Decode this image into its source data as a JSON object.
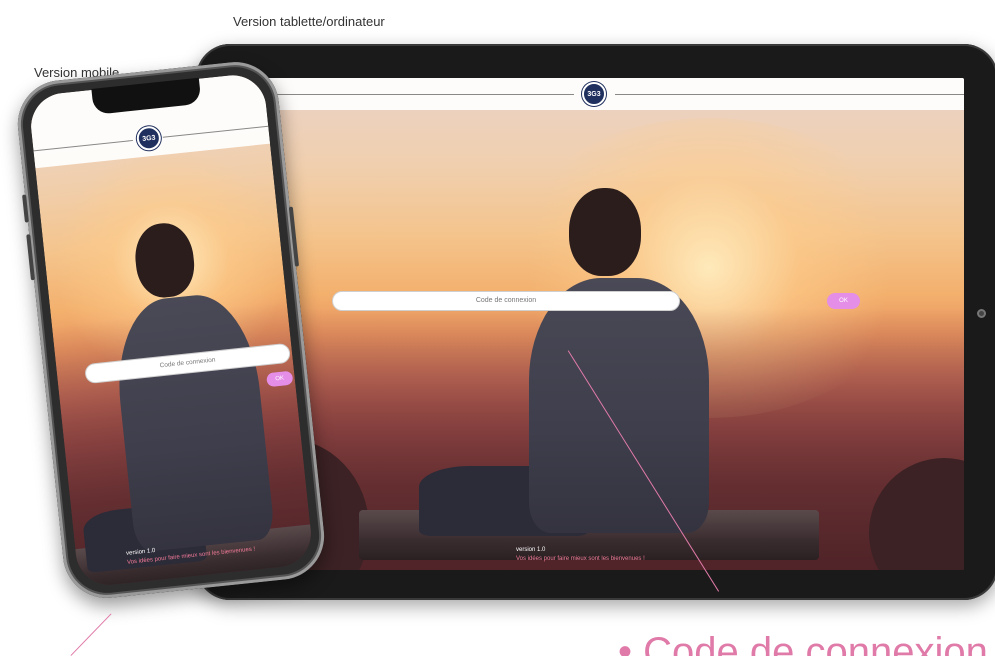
{
  "captions": {
    "tablet": "Version tablette/ordinateur",
    "mobile": "Version mobile"
  },
  "app": {
    "logo_text": "3G3",
    "code_placeholder": "Code de connexion",
    "ok_label": "OK",
    "version": "version 1.0",
    "welcome": "Vos idées pour faire mieux sont les bienvenues !"
  },
  "callout": {
    "text": "• Code de connexion"
  },
  "colors": {
    "accent_pink": "#e48ee8",
    "callout_pink": "#e07aa8",
    "logo_navy": "#1f2f5e"
  },
  "icons": {
    "logo": "app-logo-icon",
    "camera": "front-camera-icon"
  }
}
